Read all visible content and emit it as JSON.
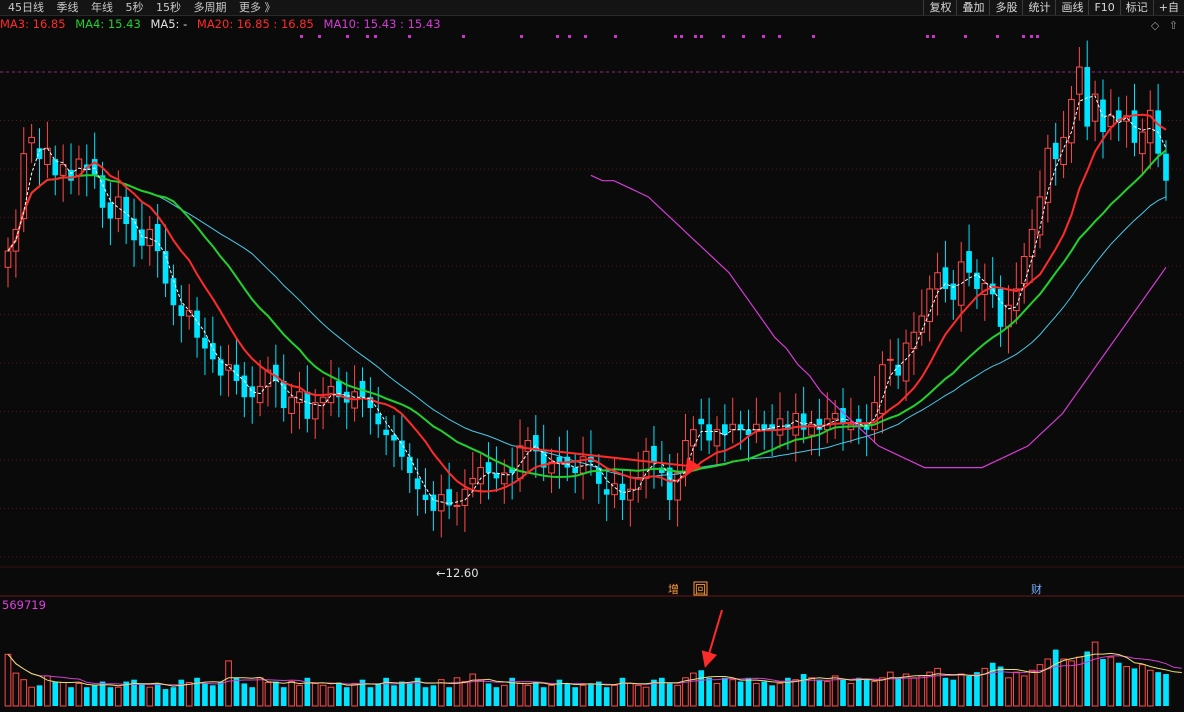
{
  "toolbar": {
    "periods": [
      "45日线",
      "季线",
      "年线",
      "5秒",
      "15秒",
      "多周期",
      "更多 》"
    ],
    "tools": [
      "复权",
      "叠加",
      "多股",
      "统计",
      "画线",
      "F10",
      "标记",
      "+自"
    ]
  },
  "ma_legend": {
    "ma3": "MA3: 16.85",
    "ma4": "MA4: 15.43",
    "ma5": "MA5: -",
    "ma20": "MA20: 16.85 : 16.85",
    "ma10": "MA10: 15.43 : 15.43"
  },
  "corner_icons": {
    "diamond": "◇",
    "up": "⇧"
  },
  "colors": {
    "up": "#ff4a4a",
    "down": "#00e4ff",
    "ma_fast": "#ffffff",
    "ma_short": "#ff2a2a",
    "ma_green": "#22d22c",
    "ma_cyan": "#4ac8e8",
    "ma_long": "#d43cd4",
    "grid": "#5a1414",
    "marker": "#cc33cc",
    "annotation": "#ff2a2a",
    "volume_ma_1": "#e8e070",
    "volume_ma_2": "#d040d0"
  },
  "price_low_label": "←12.60",
  "event_badges": {
    "zeng": "增",
    "hui": "回",
    "cai": "财"
  },
  "volume_label": "569719",
  "chart_data": {
    "type": "candlestick",
    "price_range": [
      11.8,
      21.5
    ],
    "low_value": 12.6,
    "closes": [
      17.6,
      18.0,
      19.4,
      19.7,
      19.3,
      19.5,
      19.0,
      19.2,
      18.9,
      19.3,
      19.1,
      19.0,
      18.4,
      18.2,
      18.6,
      18.1,
      17.8,
      17.7,
      18.0,
      17.6,
      17.0,
      16.6,
      16.4,
      16.5,
      16.0,
      15.8,
      15.6,
      15.3,
      15.5,
      15.2,
      14.9,
      14.9,
      15.1,
      15.4,
      15.2,
      14.7,
      14.9,
      15.0,
      14.5,
      14.8,
      14.9,
      15.1,
      14.9,
      14.8,
      15.0,
      14.9,
      14.7,
      14.4,
      14.2,
      14.1,
      13.8,
      13.5,
      13.2,
      13.0,
      12.8,
      13.1,
      12.9,
      12.9,
      13.2,
      13.4,
      13.6,
      13.5,
      13.4,
      13.5,
      13.5,
      14.0,
      14.1,
      13.9,
      13.6,
      13.7,
      13.7,
      13.6,
      13.5,
      13.8,
      13.7,
      13.3,
      13.1,
      13.3,
      13.0,
      13.2,
      13.4,
      13.9,
      13.7,
      13.5,
      13.0,
      13.5,
      14.1,
      14.3,
      14.4,
      14.1,
      14.3,
      14.2,
      14.4,
      14.3,
      14.2,
      14.4,
      14.3,
      14.3,
      14.5,
      14.3,
      14.6,
      14.3,
      14.4,
      14.3,
      14.5,
      14.6,
      14.4,
      14.4,
      14.4,
      14.3,
      14.8,
      15.5,
      15.6,
      15.3,
      15.9,
      16.1,
      16.4,
      16.9,
      17.2,
      16.9,
      16.7,
      17.4,
      17.2,
      16.9,
      17.0,
      16.8,
      16.2,
      16.6,
      16.9,
      17.5,
      18.0,
      18.6,
      19.5,
      19.3,
      19.7,
      20.4,
      21.0,
      19.9,
      20.5,
      19.8,
      20.1,
      20.0,
      20.1,
      19.6,
      19.8,
      20.2,
      19.4,
      18.9
    ],
    "opens": [
      17.3,
      17.6,
      18.2,
      19.6,
      19.5,
      19.2,
      19.3,
      19.0,
      19.1,
      19.0,
      19.2,
      19.3,
      19.0,
      18.5,
      18.2,
      18.6,
      18.2,
      18.0,
      17.7,
      18.1,
      17.6,
      17.1,
      16.6,
      16.4,
      16.5,
      16.0,
      15.9,
      15.6,
      15.4,
      15.5,
      15.3,
      15.1,
      14.8,
      15.1,
      15.5,
      15.2,
      14.6,
      14.8,
      15.0,
      14.5,
      14.8,
      14.8,
      15.2,
      15.0,
      14.7,
      15.2,
      14.9,
      14.6,
      14.3,
      14.2,
      14.1,
      13.8,
      13.4,
      13.1,
      13.1,
      12.8,
      13.2,
      12.9,
      12.9,
      13.3,
      13.3,
      13.7,
      13.5,
      13.3,
      13.6,
      13.4,
      13.9,
      14.2,
      13.9,
      13.5,
      13.8,
      13.8,
      13.6,
      13.5,
      13.8,
      13.6,
      13.2,
      13.1,
      13.3,
      13.0,
      13.2,
      13.4,
      14.0,
      13.6,
      13.6,
      13.0,
      13.5,
      14.0,
      14.5,
      14.4,
      14.0,
      14.4,
      14.3,
      14.4,
      14.3,
      14.3,
      14.4,
      14.4,
      14.2,
      14.4,
      14.2,
      14.6,
      14.2,
      14.5,
      14.3,
      14.5,
      14.7,
      14.3,
      14.5,
      14.4,
      14.3,
      14.6,
      15.6,
      15.5,
      15.2,
      15.8,
      16.1,
      16.3,
      16.9,
      17.3,
      17.0,
      16.6,
      17.6,
      17.2,
      16.8,
      17.0,
      16.9,
      16.2,
      16.5,
      17.0,
      17.5,
      17.9,
      18.5,
      19.6,
      19.2,
      19.6,
      20.5,
      21.0,
      20.0,
      20.4,
      19.9,
      20.2,
      20.0,
      20.2,
      19.4,
      19.6,
      20.2,
      19.4
    ],
    "volumes_rel": [
      0.55,
      0.35,
      0.28,
      0.2,
      0.22,
      0.32,
      0.26,
      0.25,
      0.2,
      0.24,
      0.2,
      0.22,
      0.26,
      0.2,
      0.2,
      0.26,
      0.28,
      0.24,
      0.2,
      0.24,
      0.18,
      0.2,
      0.28,
      0.25,
      0.3,
      0.24,
      0.22,
      0.26,
      0.48,
      0.3,
      0.24,
      0.2,
      0.3,
      0.25,
      0.26,
      0.2,
      0.26,
      0.22,
      0.3,
      0.24,
      0.22,
      0.2,
      0.25,
      0.2,
      0.24,
      0.28,
      0.2,
      0.24,
      0.3,
      0.22,
      0.26,
      0.24,
      0.3,
      0.2,
      0.22,
      0.28,
      0.2,
      0.3,
      0.26,
      0.34,
      0.28,
      0.24,
      0.2,
      0.22,
      0.3,
      0.24,
      0.22,
      0.26,
      0.2,
      0.22,
      0.28,
      0.24,
      0.2,
      0.22,
      0.24,
      0.26,
      0.2,
      0.22,
      0.3,
      0.24,
      0.22,
      0.2,
      0.28,
      0.3,
      0.24,
      0.22,
      0.3,
      0.35,
      0.38,
      0.3,
      0.24,
      0.3,
      0.28,
      0.26,
      0.3,
      0.24,
      0.26,
      0.22,
      0.24,
      0.3,
      0.28,
      0.34,
      0.3,
      0.28,
      0.26,
      0.32,
      0.28,
      0.24,
      0.3,
      0.28,
      0.26,
      0.3,
      0.36,
      0.3,
      0.34,
      0.3,
      0.32,
      0.36,
      0.4,
      0.3,
      0.28,
      0.34,
      0.32,
      0.36,
      0.4,
      0.46,
      0.42,
      0.3,
      0.36,
      0.32,
      0.38,
      0.44,
      0.5,
      0.6,
      0.5,
      0.48,
      0.52,
      0.58,
      0.68,
      0.5,
      0.52,
      0.46,
      0.42,
      0.4,
      0.44,
      0.38,
      0.36,
      0.34,
      0.3,
      0.4
    ],
    "ma_long_levels": [
      19.0,
      18.9,
      18.9,
      18.8,
      18.7,
      18.6,
      18.4,
      18.2,
      18.0,
      17.8,
      17.6,
      17.4,
      17.2,
      16.9,
      16.6,
      16.3,
      16.0,
      15.8,
      15.5,
      15.3,
      15.0,
      14.8,
      14.6,
      14.4,
      14.2,
      14.0,
      13.9,
      13.8,
      13.7,
      13.6,
      13.6,
      13.6,
      13.6,
      13.6,
      13.6,
      13.7,
      13.8,
      13.9,
      14.0,
      14.2,
      14.4,
      14.6,
      14.9,
      15.2,
      15.5,
      15.8,
      16.1,
      16.4,
      16.7,
      17.0,
      17.3
    ]
  }
}
